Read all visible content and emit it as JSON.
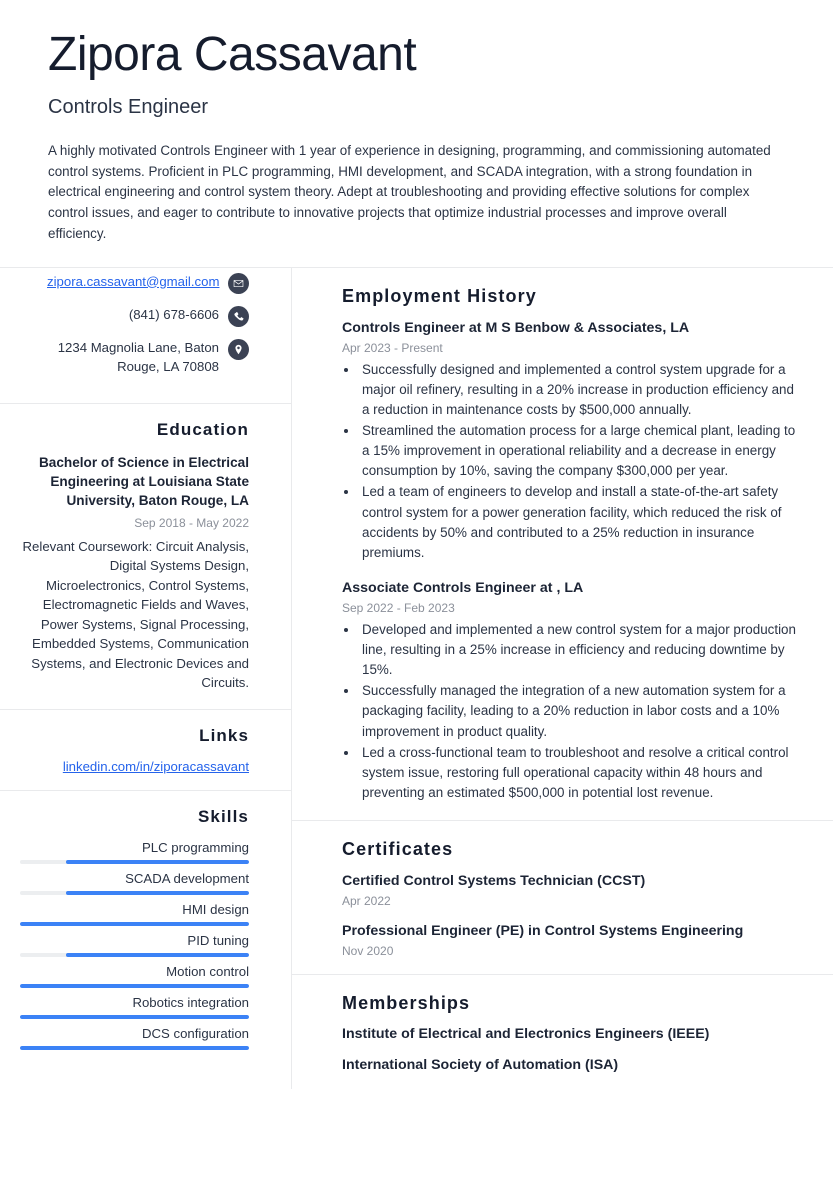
{
  "header": {
    "full_name": "Zipora Cassavant",
    "job_title": "Controls Engineer",
    "summary": "A highly motivated Controls Engineer with 1 year of experience in designing, programming, and commissioning automated control systems. Proficient in PLC programming, HMI development, and SCADA integration, with a strong foundation in electrical engineering and control system theory. Adept at troubleshooting and providing effective solutions for complex control issues, and eager to contribute to innovative projects that optimize industrial processes and improve overall efficiency."
  },
  "contact": {
    "email": "zipora.cassavant@gmail.com",
    "phone": "(841) 678-6606",
    "address": "1234 Magnolia Lane, Baton Rouge, LA 70808",
    "icons": {
      "email": "envelope-icon",
      "phone": "phone-icon",
      "address": "location-pin-icon"
    }
  },
  "education": {
    "heading": "Education",
    "degree": "Bachelor of Science in Electrical Engineering at Louisiana State University, Baton Rouge, LA",
    "date": "Sep 2018 - May 2022",
    "description": "Relevant Coursework: Circuit Analysis, Digital Systems Design, Microelectronics, Control Systems, Electromagnetic Fields and Waves, Power Systems, Signal Processing, Embedded Systems, Communication Systems, and Electronic Devices and Circuits."
  },
  "links": {
    "heading": "Links",
    "items": [
      {
        "label": "linkedin.com/in/ziporacassavant"
      }
    ]
  },
  "skills": {
    "heading": "Skills",
    "accent_color": "#3b82f6",
    "track_color": "#eceef0",
    "items": [
      {
        "label": "PLC programming",
        "level": 80
      },
      {
        "label": "SCADA development",
        "level": 80
      },
      {
        "label": "HMI design",
        "level": 100
      },
      {
        "label": "PID tuning",
        "level": 80
      },
      {
        "label": "Motion control",
        "level": 100
      },
      {
        "label": "Robotics integration",
        "level": 100
      },
      {
        "label": "DCS configuration",
        "level": 100
      }
    ]
  },
  "employment": {
    "heading": "Employment History",
    "entries": [
      {
        "title": "Controls Engineer at M S Benbow & Associates, LA",
        "date": "Apr 2023 - Present",
        "bullets": [
          "Successfully designed and implemented a control system upgrade for a major oil refinery, resulting in a 20% increase in production efficiency and a reduction in maintenance costs by $500,000 annually.",
          "Streamlined the automation process for a large chemical plant, leading to a 15% improvement in operational reliability and a decrease in energy consumption by 10%, saving the company $300,000 per year.",
          "Led a team of engineers to develop and install a state-of-the-art safety control system for a power generation facility, which reduced the risk of accidents by 50% and contributed to a 25% reduction in insurance premiums."
        ]
      },
      {
        "title": "Associate Controls Engineer at , LA",
        "date": "Sep 2022 - Feb 2023",
        "bullets": [
          "Developed and implemented a new control system for a major production line, resulting in a 25% increase in efficiency and reducing downtime by 15%.",
          "Successfully managed the integration of a new automation system for a packaging facility, leading to a 20% reduction in labor costs and a 10% improvement in product quality.",
          "Led a cross-functional team to troubleshoot and resolve a critical control system issue, restoring full operational capacity within 48 hours and preventing an estimated $500,000 in potential lost revenue."
        ]
      }
    ]
  },
  "certificates": {
    "heading": "Certificates",
    "entries": [
      {
        "title": "Certified Control Systems Technician (CCST)",
        "date": "Apr 2022"
      },
      {
        "title": "Professional Engineer (PE) in Control Systems Engineering",
        "date": "Nov 2020"
      }
    ]
  },
  "memberships": {
    "heading": "Memberships",
    "entries": [
      {
        "title": "Institute of Electrical and Electronics Engineers (IEEE)"
      },
      {
        "title": "International Society of Automation (ISA)"
      }
    ]
  }
}
